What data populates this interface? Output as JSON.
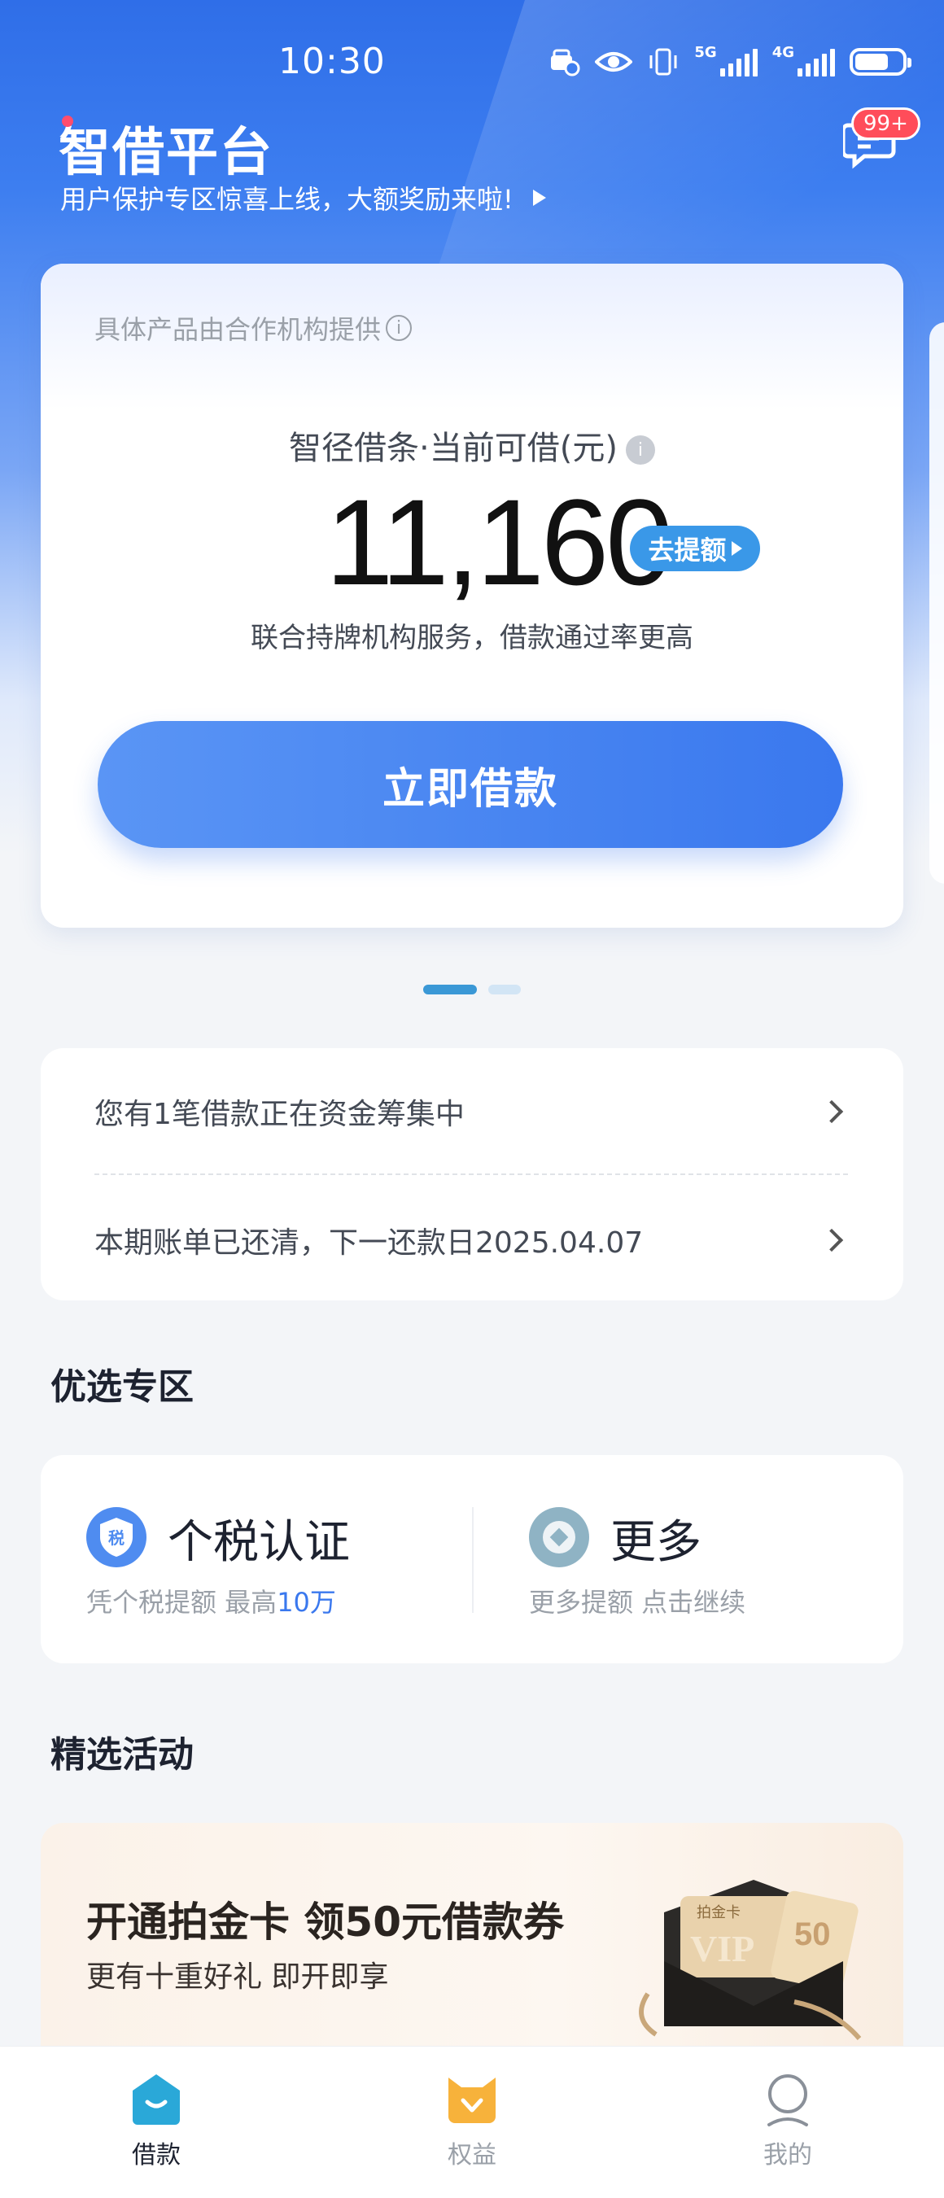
{
  "status_bar": {
    "time": "10:30",
    "net1": "5G",
    "net2": "4G"
  },
  "header": {
    "title": "智借平台",
    "banner_text": "用户保护专区惊喜上线，大额奖励来啦!",
    "message_badge": "99+"
  },
  "loan_card": {
    "provider_note": "具体产品由合作机构提供",
    "amount_label": "智径借条·当前可借(元)",
    "amount": "11,160",
    "raise_button": "去提额",
    "service_note": "联合持牌机构服务，借款通过率更高",
    "borrow_button": "立即借款"
  },
  "carousel": {
    "pages": 2,
    "active": 1
  },
  "notices": [
    {
      "text": "您有1笔借款正在资金筹集中"
    },
    {
      "text": "本期账单已还清，下一还款日2025.04.07"
    }
  ],
  "featured": {
    "heading": "优选专区",
    "items": [
      {
        "title": "个税认证",
        "sub_prefix": "凭个税提额 最高",
        "sub_highlight": "10万",
        "icon_text": "税"
      },
      {
        "title": "更多",
        "sub_prefix": "更多提额 点击继续",
        "sub_highlight": ""
      }
    ]
  },
  "activities": {
    "heading": "精选活动",
    "banner_title": "开通拍金卡 领50元借款券",
    "banner_sub": "更有十重好礼 即开即享",
    "card_label": "拍金卡",
    "card_vip": "VIP",
    "coupon_value": "50"
  },
  "bottom_nav": {
    "items": [
      {
        "label": "借款",
        "icon": "home-loan-icon",
        "active": true
      },
      {
        "label": "权益",
        "icon": "rights-cat-icon",
        "active": false
      },
      {
        "label": "我的",
        "icon": "profile-icon",
        "active": false
      }
    ]
  },
  "colors": {
    "primary": "#3a78ee",
    "accent_blue": "#3a98e8",
    "badge": "#ff4d5a"
  }
}
